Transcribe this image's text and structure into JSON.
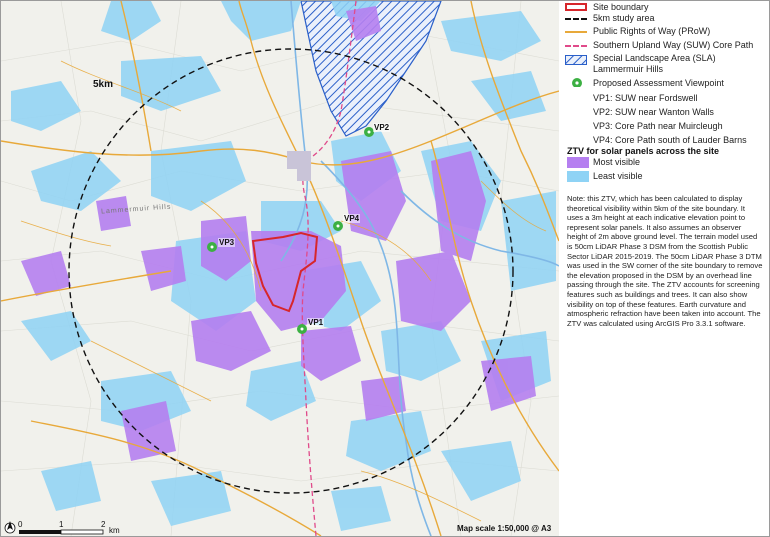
{
  "map": {
    "study_area_label": "5km",
    "hills_label": "Lammermuir Hills",
    "viewpoints": [
      {
        "id": "VP1",
        "label": "VP1"
      },
      {
        "id": "VP2",
        "label": "VP2"
      },
      {
        "id": "VP3",
        "label": "VP3"
      },
      {
        "id": "VP4",
        "label": "VP4"
      }
    ],
    "scale_bar": {
      "ticks": [
        "0",
        "1",
        "2"
      ],
      "unit": "km"
    },
    "map_scale": "Map scale 1:50,000 @ A3",
    "north_icon": "north-arrow-icon"
  },
  "legend": {
    "items": {
      "site_boundary": "Site boundary",
      "study_area": "5km study area",
      "prow": "Public Rights of Way (PRoW)",
      "suw": "Southern Upland Way (SUW) Core Path",
      "sla": "Special Landscape Area (SLA) Lammermuir Hills",
      "viewpoint": "Proposed Assessment Viewpoint"
    },
    "viewpoint_list": [
      "VP1: SUW near Fordswell",
      "VP2: SUW near Wanton Walls",
      "VP3: Core Path near Muircleugh",
      "VP4: Core Path south of Lauder Barns"
    ],
    "ztv_title": "ZTV for solar panels across the site",
    "ztv_most": "Most visible",
    "ztv_least": "Least visible",
    "note": "Note: this ZTV, which has been calculated to display theoretical visibility within 5km of the site boundary. It uses a 3m height at each indicative elevation point to represent solar panels. It also assumes an observer height of 2m above ground level. The terrain model used is 50cm LiDAR Phase 3 DSM from the Scottish Public Sector LiDAR 2015-2019. The 50cm LiDAR Phase 3 DTM was used in the SW corner of the site boundary to remove the elevation proposed in the DSM by an overhead line passing through the site. The ZTV accounts for screening features such as buildings and trees. It can also show visibility on top of these features. Earth curvature and atmospheric refraction have been taken into account. The ZTV was calculated using ArcGIS Pro 3.3.1 software."
  },
  "colors": {
    "site_boundary": "#d7262b",
    "study_area": "#111111",
    "prow": "#e8a93a",
    "suw": "#e04a8a",
    "sla": "#2a5fc9",
    "viewpoint": "#3cb043",
    "ztv_most": "#b57ff0",
    "ztv_least": "#8fd3f5",
    "river": "#7fb7e6"
  }
}
